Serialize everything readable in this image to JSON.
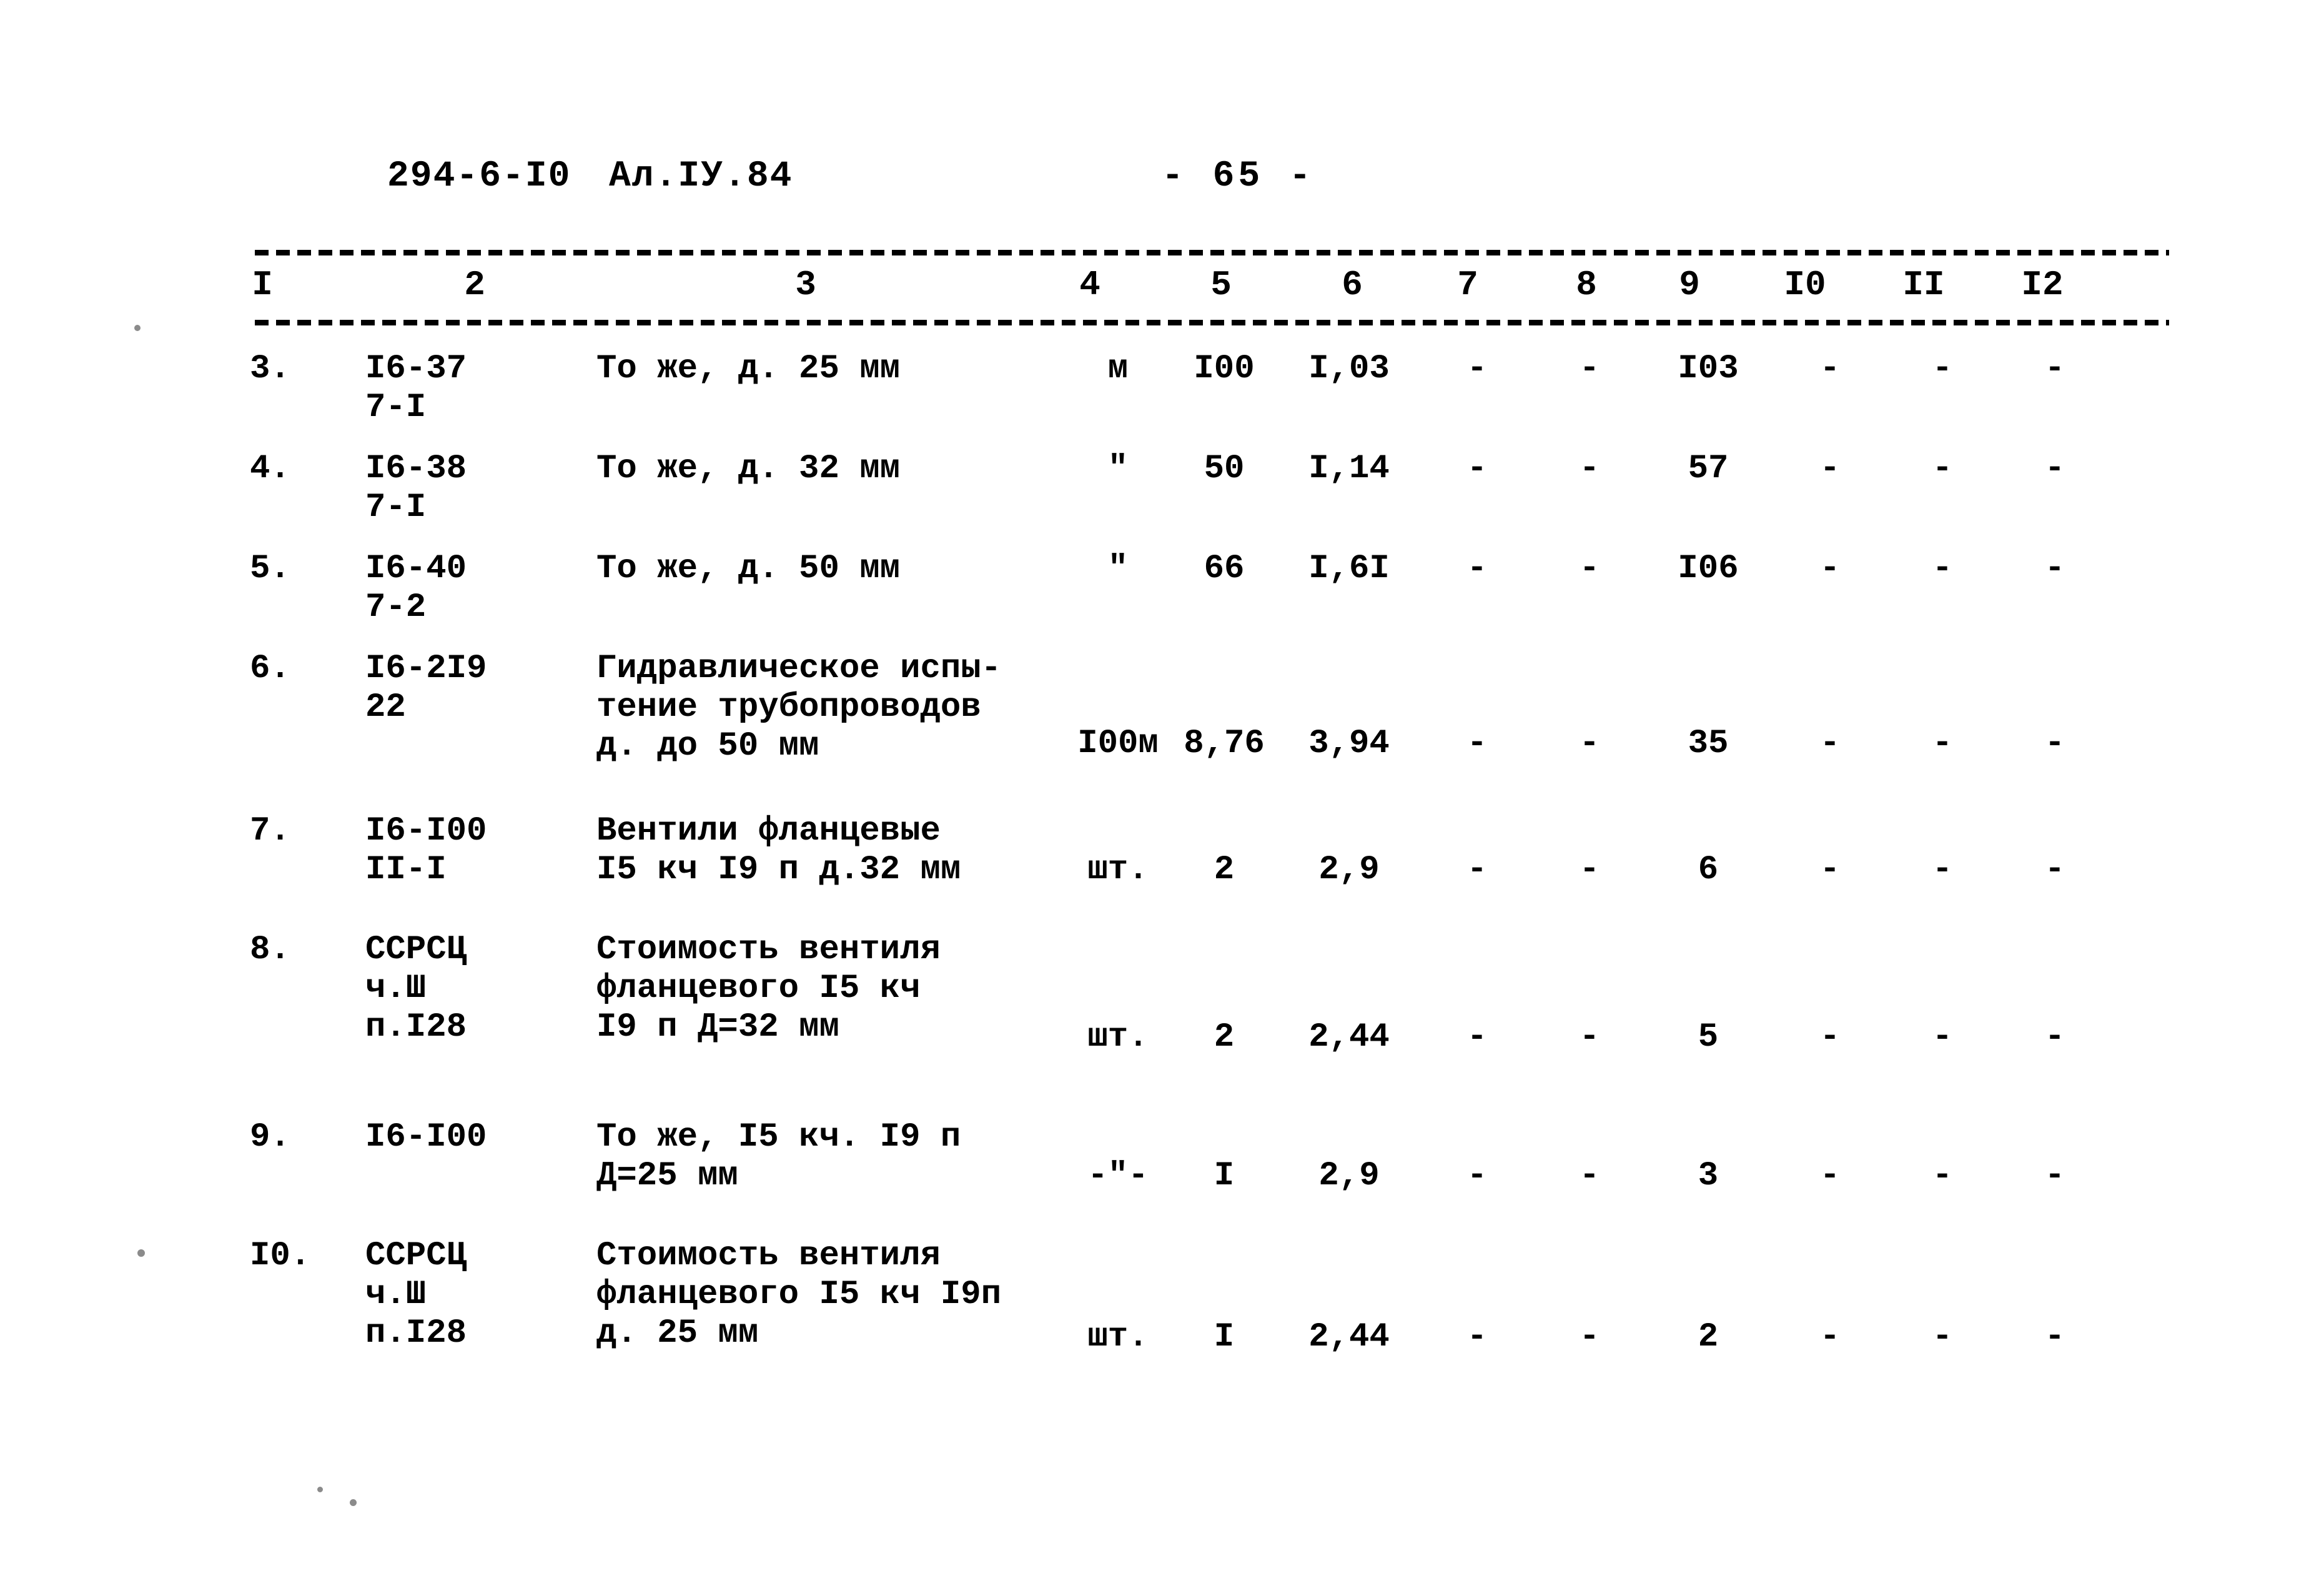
{
  "header": {
    "doc_code": "294-6-I0",
    "album": "Ал.IУ.84",
    "page_number": "- 65 -"
  },
  "table": {
    "column_headers": [
      "I",
      "2",
      "3",
      "4",
      "5",
      "6",
      "7",
      "8",
      "9",
      "I0",
      "II",
      "I2"
    ],
    "rows": [
      {
        "no": "3.",
        "code_line1": "I6-37",
        "code_line2": "7-I",
        "desc_line1": "То же, д. 25 мм",
        "desc_line2": "",
        "desc_line3": "",
        "unit": "м",
        "q4": "I00",
        "q5": "I,03",
        "q6": "-",
        "q7": "-",
        "q8": "I03",
        "q9": "-",
        "q10": "-",
        "q11": "-"
      },
      {
        "no": "4.",
        "code_line1": "I6-38",
        "code_line2": "7-I",
        "desc_line1": "То же, д. 32 мм",
        "desc_line2": "",
        "desc_line3": "",
        "unit": "\"",
        "q4": "50",
        "q5": "I,14",
        "q6": "-",
        "q7": "-",
        "q8": "57",
        "q9": "-",
        "q10": "-",
        "q11": "-"
      },
      {
        "no": "5.",
        "code_line1": "I6-40",
        "code_line2": "7-2",
        "desc_line1": "То же, д. 50 мм",
        "desc_line2": "",
        "desc_line3": "",
        "unit": "\"",
        "q4": "66",
        "q5": "I,6I",
        "q6": "-",
        "q7": "-",
        "q8": "I06",
        "q9": "-",
        "q10": "-",
        "q11": "-"
      },
      {
        "no": "6.",
        "code_line1": "I6-2I9",
        "code_line2": "22",
        "desc_line1": "Гидравлическое испы-",
        "desc_line2": "тение трубопроводов",
        "desc_line3": "д. до 50 мм",
        "unit": "I00м",
        "q4": "8,76",
        "q5": "3,94",
        "q6": "-",
        "q7": "-",
        "q8": "35",
        "q9": "-",
        "q10": "-",
        "q11": "-"
      },
      {
        "no": "7.",
        "code_line1": "I6-I00",
        "code_line2": "II-I",
        "desc_line1": "Вентили фланцевые",
        "desc_line2": "I5 кч I9 п д.32 мм",
        "desc_line3": "",
        "unit": "шт.",
        "q4": "2",
        "q5": "2,9",
        "q6": "-",
        "q7": "-",
        "q8": "6",
        "q9": "-",
        "q10": "-",
        "q11": "-"
      },
      {
        "no": "8.",
        "code_line1": "ССРСЦ",
        "code_line2": "ч.Ш",
        "code_line3": "п.I28",
        "desc_line1": "Стоимость вентиля",
        "desc_line2": "фланцевого I5 кч",
        "desc_line3": "I9 п Д=32 мм",
        "unit": "шт.",
        "q4": "2",
        "q5": "2,44",
        "q6": "-",
        "q7": "-",
        "q8": "5",
        "q9": "-",
        "q10": "-",
        "q11": "-"
      },
      {
        "no": "9.",
        "code_line1": "I6-I00",
        "code_line2": "",
        "desc_line1": "То же, I5 кч. I9 п",
        "desc_line2": "Д=25 мм",
        "desc_line3": "",
        "unit": "-\"-",
        "q4": "I",
        "q5": "2,9",
        "q6": "-",
        "q7": "-",
        "q8": "3",
        "q9": "-",
        "q10": "-",
        "q11": "-"
      },
      {
        "no": "I0.",
        "code_line1": "ССРСЦ",
        "code_line2": "ч.Ш",
        "code_line3": "п.I28",
        "desc_line1": "Стоимость вентиля",
        "desc_line2": "фланцевого I5 кч I9п",
        "desc_line3": "д. 25 мм",
        "unit": "шт.",
        "q4": "I",
        "q5": "2,44",
        "q6": "-",
        "q7": "-",
        "q8": "2",
        "q9": "-",
        "q10": "-",
        "q11": "-"
      }
    ]
  }
}
